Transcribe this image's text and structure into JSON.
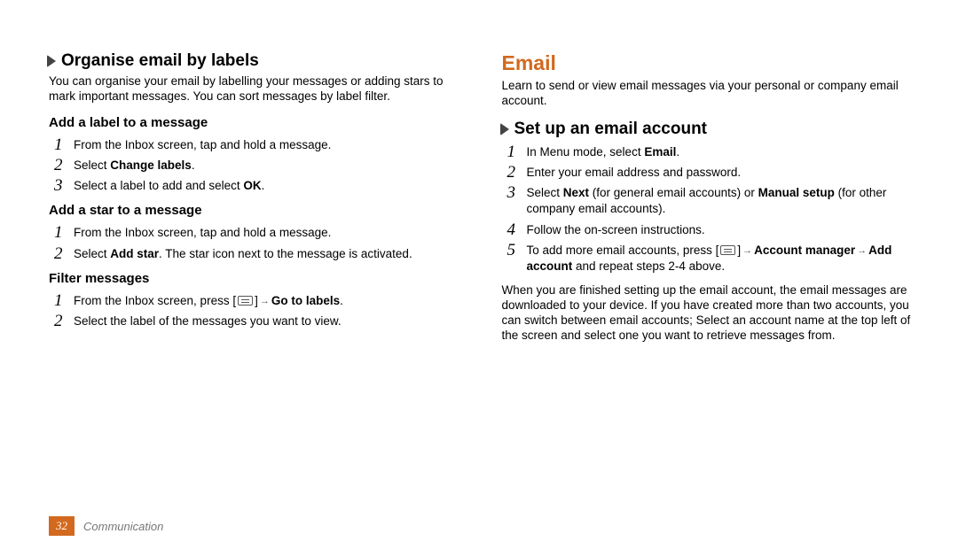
{
  "left": {
    "heading": "Organise email by labels",
    "intro": "You can organise your email by labelling your messages or adding stars to mark important messages. You can sort messages by label filter.",
    "addLabel": {
      "title": "Add a label to a message",
      "s1": "From the Inbox screen, tap and hold a message.",
      "s2a": "Select ",
      "s2b": "Change labels",
      "s2c": ".",
      "s3a": "Select a label to add and select ",
      "s3b": "OK",
      "s3c": "."
    },
    "addStar": {
      "title": "Add a star to a message",
      "s1": "From the Inbox screen, tap and hold a message.",
      "s2a": "Select ",
      "s2b": "Add star",
      "s2c": ". The star icon next to the message is activated."
    },
    "filter": {
      "title": "Filter messages",
      "s1a": "From the Inbox screen, press [",
      "s1b": "Go to labels",
      "s1c": ".",
      "s2": "Select the label of the messages you want to view."
    }
  },
  "right": {
    "h1": "Email",
    "intro": "Learn to send or view email messages via your personal or company email account.",
    "setup": {
      "heading": "Set up an email account",
      "s1a": "In Menu mode, select ",
      "s1b": "Email",
      "s1c": ".",
      "s2": "Enter your email address and password.",
      "s3a": "Select ",
      "s3b": "Next",
      "s3c": " (for general email accounts) or ",
      "s3d": "Manual setup",
      "s3e": " (for other company email accounts).",
      "s4": "Follow the on-screen instructions.",
      "s5a": "To add more email accounts, press [",
      "s5b": "Account manager",
      "s5c": "Add account",
      "s5d": " and repeat steps 2-4 above."
    },
    "after": "When you are finished setting up the email account, the email messages are downloaded to your device. If you have created more than two accounts, you can switch between email accounts; Select an account name at the top left of the screen and select one you want to retrieve messages from."
  },
  "footer": {
    "page": "32",
    "section": "Communication"
  }
}
